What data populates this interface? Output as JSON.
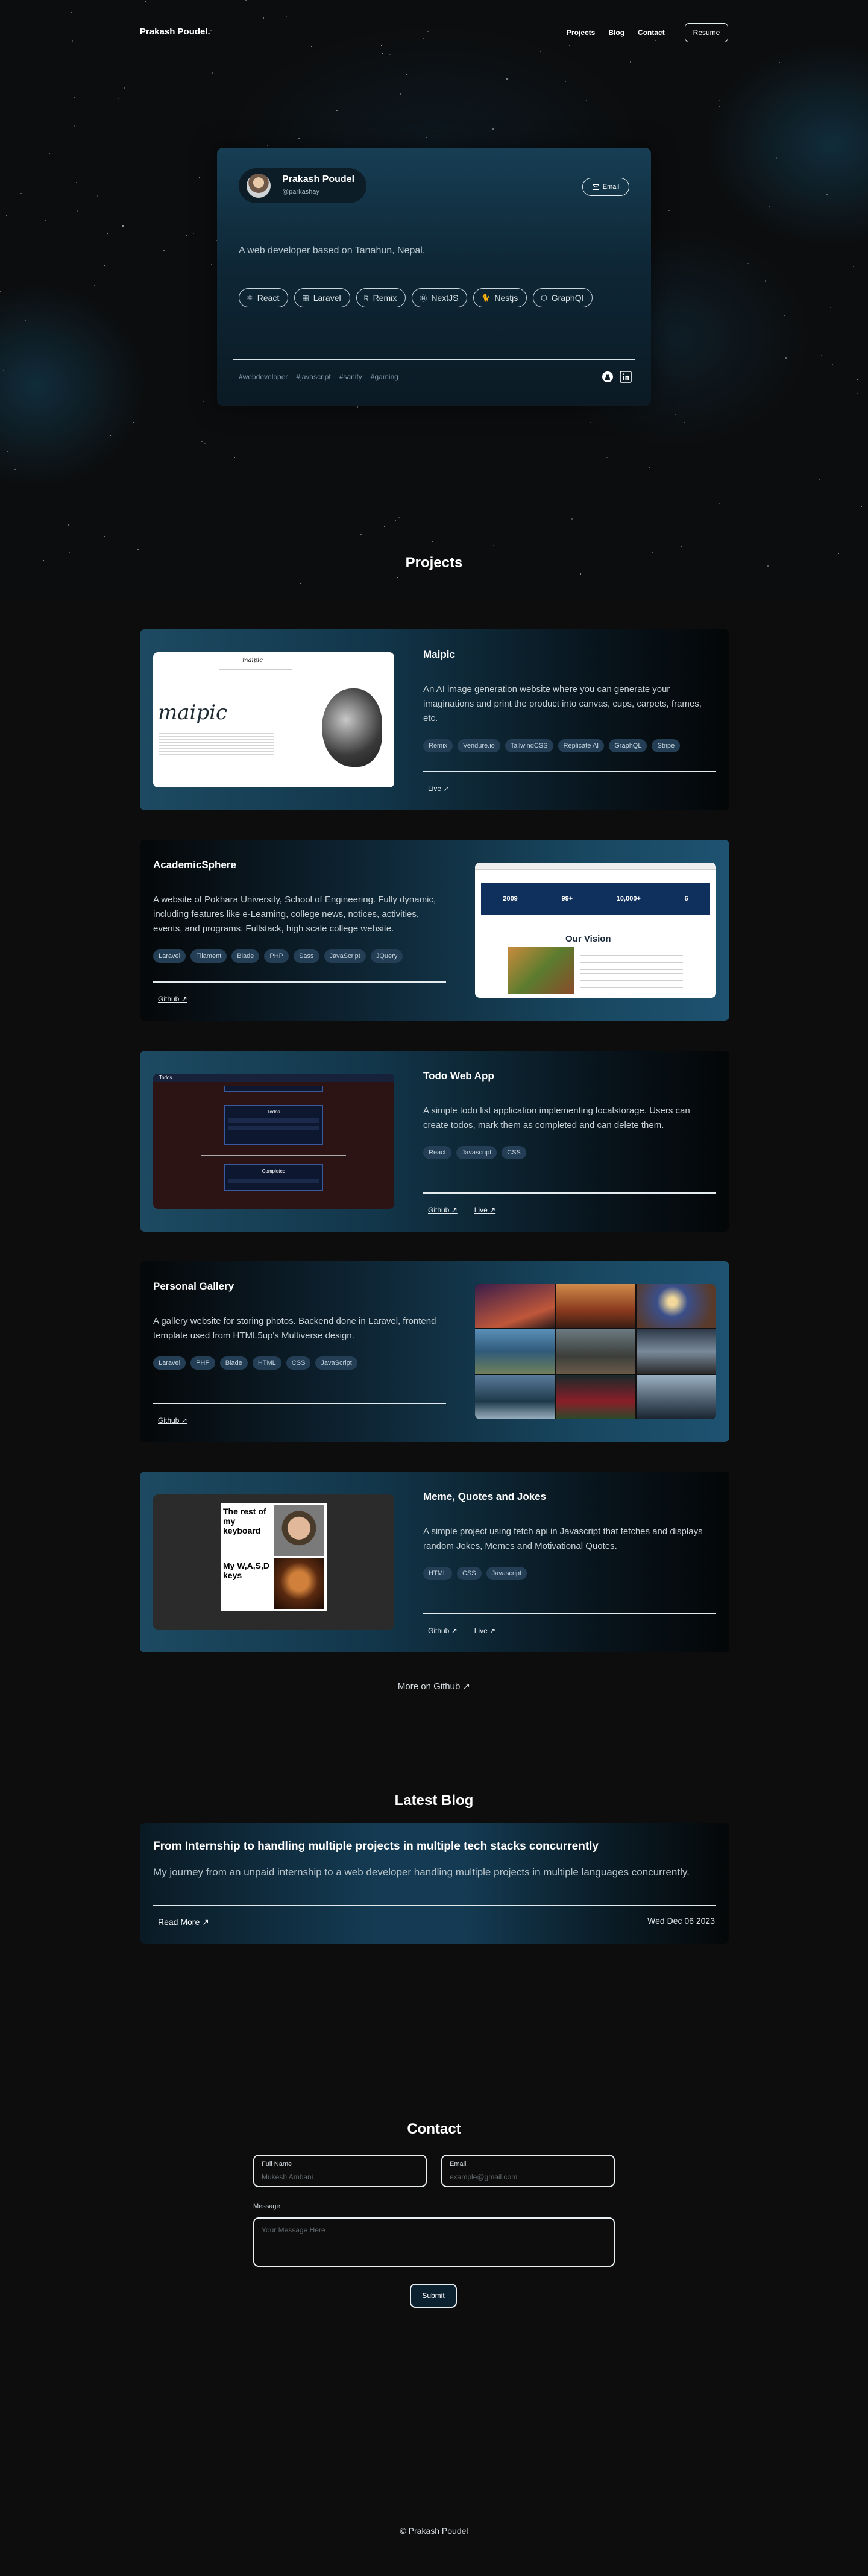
{
  "nav": {
    "logo": "Prakash Poudel.",
    "links": [
      "Projects",
      "Blog",
      "Contact"
    ],
    "resume": "Resume"
  },
  "profile": {
    "name": "Prakash Poudel",
    "username": "@parkashay",
    "email_label": "Email",
    "bio": "A web developer based on Tanahun, Nepal.",
    "techs": [
      {
        "label": "React",
        "icon": "react-icon"
      },
      {
        "label": "Laravel",
        "icon": "laravel-icon"
      },
      {
        "label": "Remix",
        "icon": "remix-icon"
      },
      {
        "label": "NextJS",
        "icon": "nextjs-icon"
      },
      {
        "label": "Nestjs",
        "icon": "nestjs-icon"
      },
      {
        "label": "GraphQl",
        "icon": "graphql-icon"
      }
    ],
    "tags": [
      "#webdeveloper",
      "#javascript",
      "#sanity",
      "#gaming"
    ],
    "social": [
      "github-icon",
      "linkedin-icon"
    ]
  },
  "projects_title": "Projects",
  "projects": [
    {
      "title": "Maipic",
      "desc": "An AI image generation website where you can generate your imaginations and print the product into canvas, cups, carpets, frames, etc.",
      "stack": [
        "Remix",
        "Vendure.io",
        "TailwindCSS",
        "Replicate AI",
        "GraphQL",
        "Stripe"
      ],
      "links": [
        "Live"
      ]
    },
    {
      "title": "AcademicSphere",
      "desc": "A website of Pokhara University, School of Engineering. Fully dynamic, including features like e-Learning, college news, notices, activities, events, and programs. Fullstack, high scale college website.",
      "stack": [
        "Laravel",
        "Filament",
        "Blade",
        "PHP",
        "Sass",
        "JavaScript",
        "JQuery"
      ],
      "links": [
        "Github"
      ]
    },
    {
      "title": "Todo Web App",
      "desc": "A simple todo list application implementing localstorage. Users can create todos, mark them as completed and can delete them.",
      "stack": [
        "React",
        "Javascript",
        "CSS"
      ],
      "links": [
        "Github",
        "Live"
      ]
    },
    {
      "title": "Personal Gallery",
      "desc": "A gallery website for storing photos. Backend done in Laravel, frontend template used from HTML5up's Multiverse design.",
      "stack": [
        "Laravel",
        "PHP",
        "Blade",
        "HTML",
        "CSS",
        "JavaScript"
      ],
      "links": [
        "Github"
      ]
    },
    {
      "title": "Meme, Quotes and Jokes",
      "desc": "A simple project using fetch api in Javascript that fetches and displays random Jokes, Memes and Motivational Quotes.",
      "stack": [
        "HTML",
        "CSS",
        "Javascript"
      ],
      "links": [
        "Github",
        "Live"
      ]
    }
  ],
  "shots": {
    "maipic_logo": "maipic",
    "academic": {
      "stats": [
        "2009",
        "99+",
        "10,000+",
        "6"
      ],
      "heading": "Our Vision"
    },
    "todo": {
      "header": "Todos",
      "todos": "Todos",
      "completed": "Completed"
    },
    "meme": {
      "top": "The rest of my keyboard",
      "bottom": "My W,A,S,D keys"
    }
  },
  "more_github": "More on Github",
  "blog_title": "Latest Blog",
  "blog": {
    "title": "From Internship to handling multiple projects in multiple tech stacks concurrently",
    "desc": "My journey from an unpaid internship to a web developer handling multiple projects in multiple languages concurrently.",
    "read_more": "Read More",
    "date": "Wed Dec 06 2023"
  },
  "contact": {
    "title": "Contact",
    "name_label": "Full Name",
    "name_ph": "Mukesh Ambani",
    "email_label": "Email",
    "email_ph": "example@gmail.com",
    "message_label": "Message",
    "message_ph": "Your Message Here",
    "submit": "Submit"
  },
  "footer": "© Prakash Poudel"
}
